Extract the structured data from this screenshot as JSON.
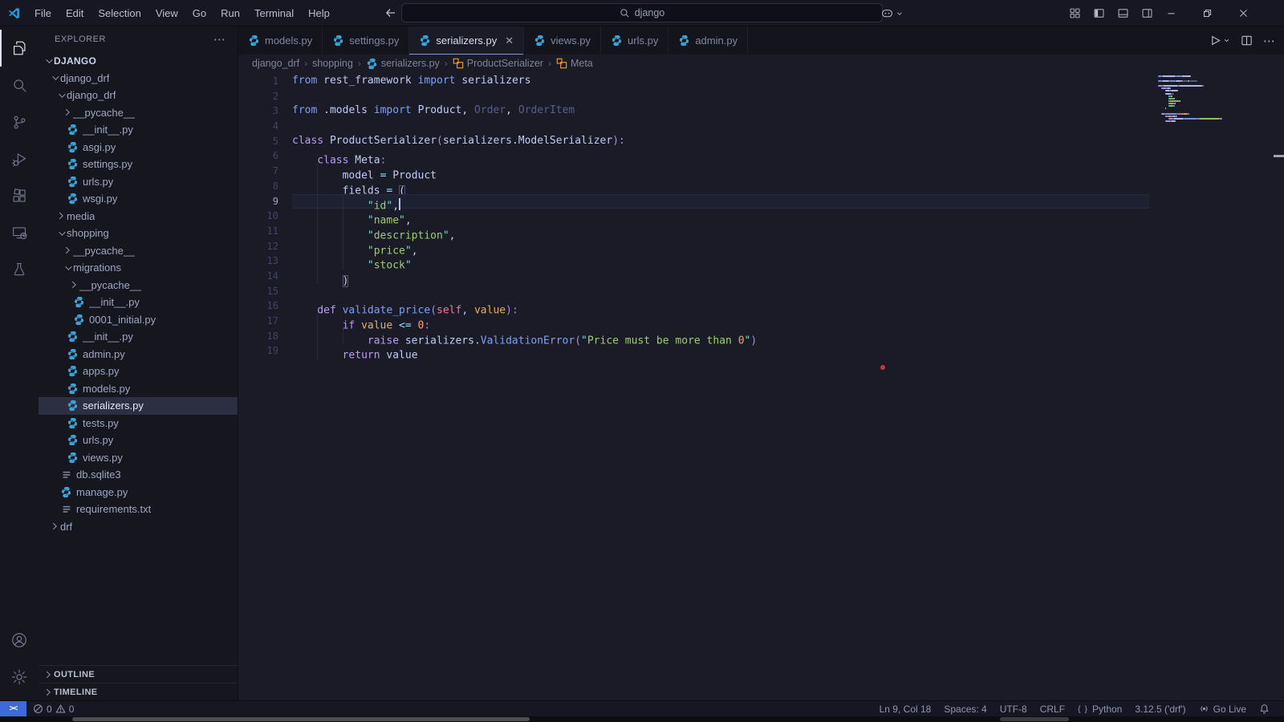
{
  "window": {
    "menu": [
      "File",
      "Edit",
      "Selection",
      "View",
      "Go",
      "Run",
      "Terminal",
      "Help"
    ],
    "search": {
      "value": "django"
    },
    "controls": [
      "minimize",
      "restore",
      "close"
    ]
  },
  "activity_bar": {
    "top": [
      {
        "name": "explorer",
        "icon": "files",
        "active": true
      },
      {
        "name": "search",
        "icon": "search",
        "active": false
      },
      {
        "name": "source-control",
        "icon": "scm",
        "active": false
      },
      {
        "name": "run-debug",
        "icon": "debug",
        "active": false
      },
      {
        "name": "extensions",
        "icon": "extensions",
        "active": false
      },
      {
        "name": "remote-explorer",
        "icon": "remote-explorer",
        "active": false
      },
      {
        "name": "testing",
        "icon": "beaker",
        "active": false
      }
    ],
    "bottom": [
      {
        "name": "accounts",
        "icon": "account",
        "active": false
      },
      {
        "name": "settings",
        "icon": "gear",
        "active": false
      }
    ]
  },
  "explorer": {
    "title": "EXPLORER",
    "more_label": "⋯",
    "root": "DJANGO",
    "tree": [
      {
        "label": "django_drf",
        "level": 1,
        "kind": "folder",
        "expanded": true
      },
      {
        "label": "django_drf",
        "level": 2,
        "kind": "folder",
        "expanded": true
      },
      {
        "label": "__pycache__",
        "level": 3,
        "kind": "folder",
        "expanded": false
      },
      {
        "label": "__init__.py",
        "level": 3,
        "kind": "python"
      },
      {
        "label": "asgi.py",
        "level": 3,
        "kind": "python"
      },
      {
        "label": "settings.py",
        "level": 3,
        "kind": "python"
      },
      {
        "label": "urls.py",
        "level": 3,
        "kind": "python"
      },
      {
        "label": "wsgi.py",
        "level": 3,
        "kind": "python"
      },
      {
        "label": "media",
        "level": 2,
        "kind": "folder",
        "expanded": false
      },
      {
        "label": "shopping",
        "level": 2,
        "kind": "folder",
        "expanded": true
      },
      {
        "label": "__pycache__",
        "level": 3,
        "kind": "folder",
        "expanded": false
      },
      {
        "label": "migrations",
        "level": 3,
        "kind": "folder",
        "expanded": true
      },
      {
        "label": "__pycache__",
        "level": 4,
        "kind": "folder",
        "expanded": false
      },
      {
        "label": "__init__.py",
        "level": 4,
        "kind": "python"
      },
      {
        "label": "0001_initial.py",
        "level": 4,
        "kind": "python"
      },
      {
        "label": "__init__.py",
        "level": 3,
        "kind": "python"
      },
      {
        "label": "admin.py",
        "level": 3,
        "kind": "python"
      },
      {
        "label": "apps.py",
        "level": 3,
        "kind": "python"
      },
      {
        "label": "models.py",
        "level": 3,
        "kind": "python"
      },
      {
        "label": "serializers.py",
        "level": 3,
        "kind": "python",
        "selected": true
      },
      {
        "label": "tests.py",
        "level": 3,
        "kind": "python"
      },
      {
        "label": "urls.py",
        "level": 3,
        "kind": "python"
      },
      {
        "label": "views.py",
        "level": 3,
        "kind": "python"
      },
      {
        "label": "db.sqlite3",
        "level": 2,
        "kind": "text"
      },
      {
        "label": "manage.py",
        "level": 2,
        "kind": "python"
      },
      {
        "label": "requirements.txt",
        "level": 2,
        "kind": "text"
      },
      {
        "label": "drf",
        "level": 1,
        "kind": "folder",
        "expanded": false
      }
    ],
    "sections": [
      "OUTLINE",
      "TIMELINE"
    ]
  },
  "tabs": [
    {
      "label": "models.py",
      "active": false
    },
    {
      "label": "settings.py",
      "active": false
    },
    {
      "label": "serializers.py",
      "active": true
    },
    {
      "label": "views.py",
      "active": false
    },
    {
      "label": "urls.py",
      "active": false
    },
    {
      "label": "admin.py",
      "active": false
    }
  ],
  "breadcrumb": [
    {
      "label": "django_drf",
      "icon": ""
    },
    {
      "label": "shopping",
      "icon": ""
    },
    {
      "label": "serializers.py",
      "icon": "python"
    },
    {
      "label": "ProductSerializer",
      "icon": "class"
    },
    {
      "label": "Meta",
      "icon": "class"
    }
  ],
  "editor": {
    "cursor_line": 9,
    "lines": [
      {
        "n": 1,
        "indent": 0,
        "tokens": [
          [
            "kwi",
            "from "
          ],
          [
            "pl",
            "rest_framework "
          ],
          [
            "kwi",
            "import "
          ],
          [
            "pl",
            "serializers"
          ]
        ]
      },
      {
        "n": 2,
        "indent": 0,
        "tokens": []
      },
      {
        "n": 3,
        "indent": 0,
        "tokens": [
          [
            "kwi",
            "from "
          ],
          [
            "pl",
            ".models "
          ],
          [
            "kwi",
            "import "
          ],
          [
            "pl",
            "Product"
          ],
          [
            "pl",
            ", "
          ],
          [
            "dim",
            "Order"
          ],
          [
            "pl",
            ", "
          ],
          [
            "dim",
            "OrderItem"
          ]
        ]
      },
      {
        "n": 4,
        "indent": 0,
        "tokens": []
      },
      {
        "n": 5,
        "indent": 0,
        "tokens": [
          [
            "kw",
            "class "
          ],
          [
            "pl",
            "ProductSerializer"
          ],
          [
            "pu",
            "("
          ],
          [
            "pl",
            "serializers.ModelSerializer"
          ],
          [
            "pu",
            "):"
          ]
        ]
      },
      {
        "n": 6,
        "indent": 1,
        "tokens": [
          [
            "kw",
            "class "
          ],
          [
            "pl",
            "Meta"
          ],
          [
            "pu",
            ":"
          ]
        ]
      },
      {
        "n": 7,
        "indent": 2,
        "tokens": [
          [
            "pl",
            "model "
          ],
          [
            "op",
            "="
          ],
          [
            "pl",
            " Product"
          ]
        ]
      },
      {
        "n": 8,
        "indent": 2,
        "tokens": [
          [
            "pl",
            "fields "
          ],
          [
            "op",
            "="
          ],
          [
            "pl",
            " "
          ],
          [
            "brm",
            "("
          ]
        ]
      },
      {
        "n": 9,
        "indent": 3,
        "cursor": true,
        "tokens": [
          [
            "strq",
            "\""
          ],
          [
            "str",
            "id"
          ],
          [
            "strq",
            "\""
          ],
          [
            "pl",
            ","
          ]
        ]
      },
      {
        "n": 10,
        "indent": 3,
        "tokens": [
          [
            "strq",
            "\""
          ],
          [
            "str",
            "name"
          ],
          [
            "strq",
            "\""
          ],
          [
            "pl",
            ","
          ]
        ]
      },
      {
        "n": 11,
        "indent": 3,
        "tokens": [
          [
            "strq",
            "\""
          ],
          [
            "str",
            "description"
          ],
          [
            "strq",
            "\""
          ],
          [
            "pl",
            ","
          ]
        ]
      },
      {
        "n": 12,
        "indent": 3,
        "tokens": [
          [
            "strq",
            "\""
          ],
          [
            "str",
            "price"
          ],
          [
            "strq",
            "\""
          ],
          [
            "pl",
            ","
          ]
        ]
      },
      {
        "n": 13,
        "indent": 3,
        "tokens": [
          [
            "strq",
            "\""
          ],
          [
            "str",
            "stock"
          ],
          [
            "strq",
            "\""
          ]
        ]
      },
      {
        "n": 14,
        "indent": 2,
        "tokens": [
          [
            "brm",
            ")"
          ]
        ]
      },
      {
        "n": 15,
        "indent": 0,
        "tokens": []
      },
      {
        "n": 16,
        "indent": 1,
        "tokens": [
          [
            "kw",
            "def "
          ],
          [
            "fn",
            "validate_price"
          ],
          [
            "pu",
            "("
          ],
          [
            "slf",
            "self"
          ],
          [
            "pl",
            ", "
          ],
          [
            "par",
            "value"
          ],
          [
            "pu",
            "):"
          ]
        ]
      },
      {
        "n": 17,
        "indent": 2,
        "tokens": [
          [
            "kw",
            "if "
          ],
          [
            "par",
            "value "
          ],
          [
            "op",
            "<= "
          ],
          [
            "num",
            "0"
          ],
          [
            "pu",
            ":"
          ]
        ]
      },
      {
        "n": 18,
        "indent": 3,
        "tokens": [
          [
            "kw",
            "raise "
          ],
          [
            "pl",
            "serializers."
          ],
          [
            "fn",
            "ValidationError"
          ],
          [
            "pu",
            "("
          ],
          [
            "strq",
            "\""
          ],
          [
            "str",
            "Price must be more than "
          ],
          [
            "num",
            "0"
          ],
          [
            "strq",
            "\""
          ],
          [
            "pu",
            ")"
          ]
        ]
      },
      {
        "n": 19,
        "indent": 2,
        "tokens": [
          [
            "kw",
            "return "
          ],
          [
            "pl",
            "value"
          ]
        ]
      }
    ]
  },
  "status_bar": {
    "problems": {
      "errors": "0",
      "warnings": "0"
    },
    "right": [
      {
        "name": "cursor-position",
        "label": "Ln 9, Col 18",
        "icon": ""
      },
      {
        "name": "indentation",
        "label": "Spaces: 4",
        "icon": ""
      },
      {
        "name": "encoding",
        "label": "UTF-8",
        "icon": ""
      },
      {
        "name": "eol",
        "label": "CRLF",
        "icon": ""
      },
      {
        "name": "language-mode",
        "label": "Python",
        "icon": "braces"
      },
      {
        "name": "python-interpreter",
        "label": "3.12.5 ('drf')",
        "icon": ""
      },
      {
        "name": "go-live",
        "label": "Go Live",
        "icon": "broadcast"
      },
      {
        "name": "notifications",
        "label": "",
        "icon": "bell"
      }
    ]
  },
  "colors": {
    "accent_remote": "#3c6bd9",
    "tab_active_underline": "#8697d8",
    "editor_bg": "#1a1b26",
    "sidebar_bg": "#16161e",
    "python_icon": "#3ba3d8",
    "class_icon": "#ee9d28",
    "red_dot": "#c53848",
    "syntax": {
      "kw": "#bb9af7",
      "kwi": "#7aa2f7",
      "pl": "#c0caf5",
      "dim": "#565f89",
      "op": "#89ddff",
      "num": "#ff9e64",
      "str": "#9ece6a",
      "strq": "#73daca",
      "slf": "#f7768e",
      "par": "#e0af68",
      "fn": "#7aa2f7",
      "pu": "#a48ce8",
      "brm": "#c8d0f0"
    }
  }
}
